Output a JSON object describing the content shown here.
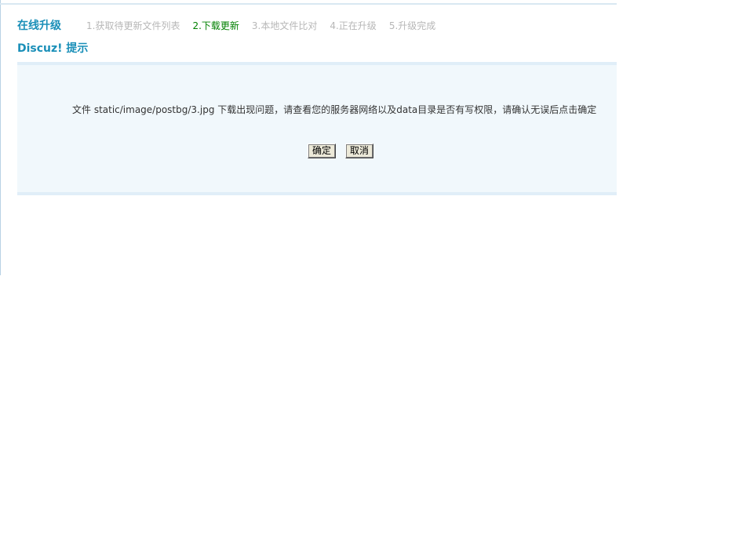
{
  "header": {
    "title": "在线升级",
    "steps": [
      {
        "label": "1.获取待更新文件列表",
        "active": false
      },
      {
        "label": "2.下载更新",
        "active": true
      },
      {
        "label": "3.本地文件比对",
        "active": false
      },
      {
        "label": "4.正在升级",
        "active": false
      },
      {
        "label": "5.升级完成",
        "active": false
      }
    ]
  },
  "dialog": {
    "title": "Discuz! 提示",
    "message": "文件 static/image/postbg/3.jpg 下载出现问题，请查看您的服务器网络以及data目录是否有写权限，请确认无误后点击确定",
    "confirm_label": "确定",
    "cancel_label": "取消"
  },
  "colors": {
    "title": "#1a8fb8",
    "active_step": "#008000",
    "inactive_step": "#b7b7b7",
    "box_background": "#f1f8fc"
  }
}
